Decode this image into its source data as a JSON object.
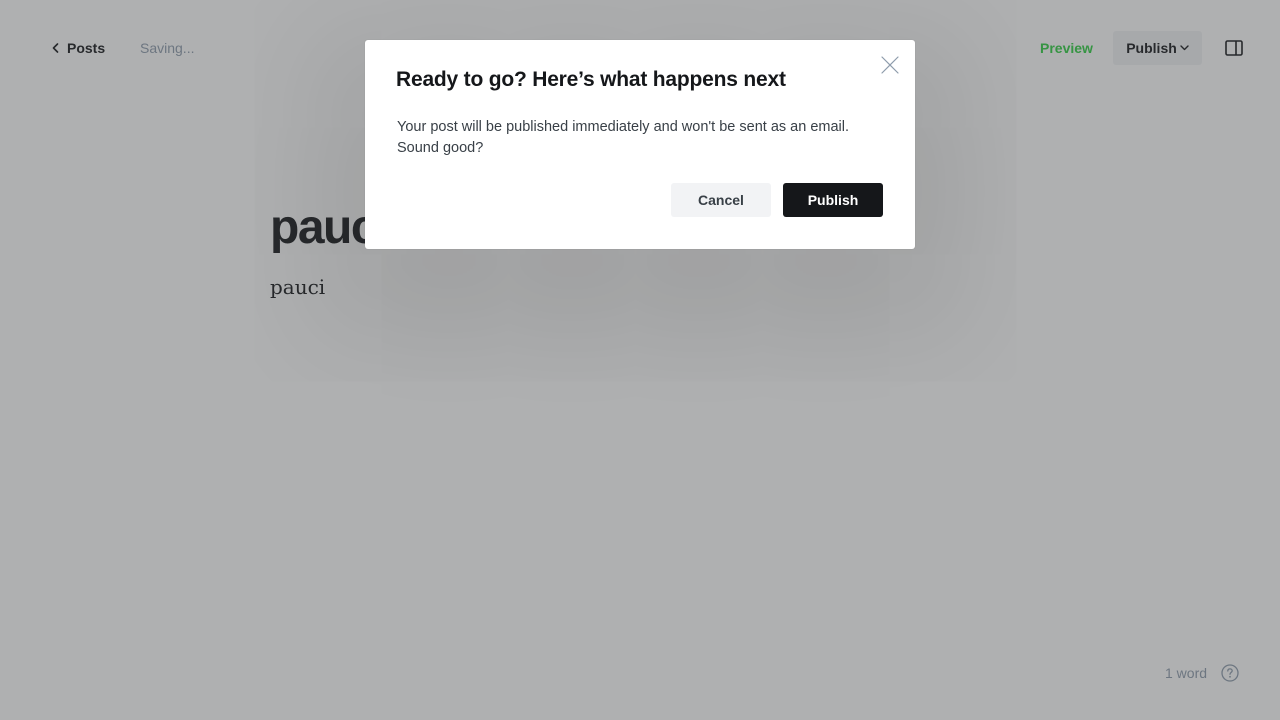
{
  "topbar": {
    "back_label": "Posts",
    "status": "Saving...",
    "preview_label": "Preview",
    "publish_label": "Publish"
  },
  "editor": {
    "title": "pauci",
    "body": "pauci"
  },
  "footer": {
    "word_count": "1 word"
  },
  "modal": {
    "title": "Ready to go? Here’s what happens next",
    "message": "Your post will be published immediately and won't be sent as an email. Sound good?",
    "cancel_label": "Cancel",
    "confirm_label": "Publish"
  },
  "icons": {
    "back": "chevron-left-icon",
    "dropdown": "chevron-down-icon",
    "sidebar": "sidebar-toggle-icon",
    "help": "help-icon",
    "close": "close-icon"
  },
  "colors": {
    "accent_green": "#30cf43",
    "publish_button": "#15171a",
    "backdrop": "rgba(64,66,70,0.42)"
  }
}
